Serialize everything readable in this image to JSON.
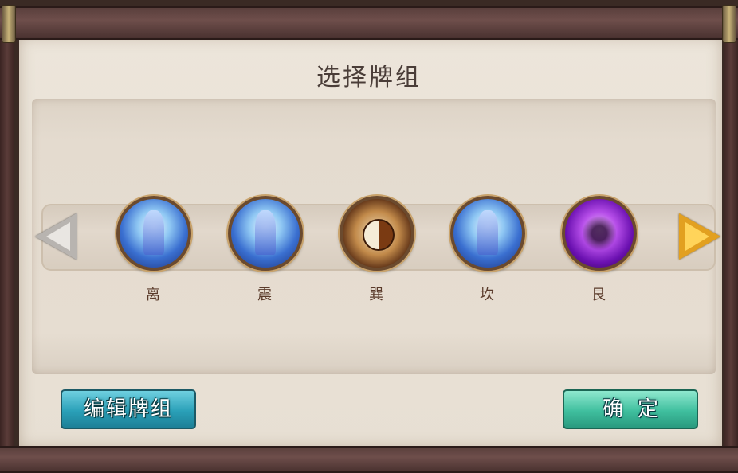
{
  "dialog": {
    "title": "选择牌组"
  },
  "decks": [
    {
      "label": "离",
      "icon": "water-mountain-icon"
    },
    {
      "label": "震",
      "icon": "water-mountain-icon"
    },
    {
      "label": "巽",
      "icon": "taiji-icon"
    },
    {
      "label": "坎",
      "icon": "water-mountain-icon"
    },
    {
      "label": "艮",
      "icon": "purple-spirit-icon"
    }
  ],
  "buttons": {
    "edit_label": "编辑牌组",
    "confirm_label": "确定"
  },
  "colors": {
    "edit_button": "#2aa0b8",
    "confirm_button": "#3fbf9e",
    "next_arrow": "#e2a020",
    "prev_arrow": "#b8b4b0"
  }
}
